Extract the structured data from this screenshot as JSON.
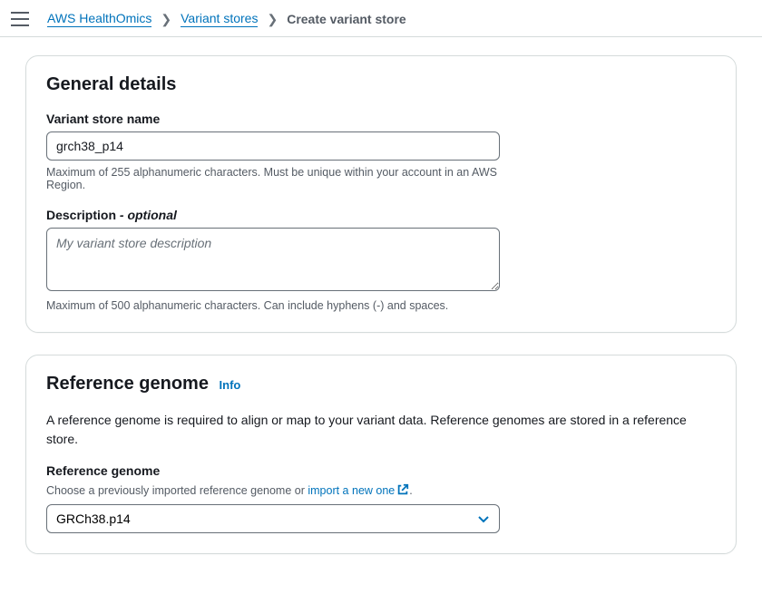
{
  "breadcrumb": {
    "root": "AWS HealthOmics",
    "mid": "Variant stores",
    "current": "Create variant store"
  },
  "general": {
    "title": "General details",
    "name_label": "Variant store name",
    "name_value": "grch38_p14",
    "name_hint": "Maximum of 255 alphanumeric characters. Must be unique within your account in an AWS Region.",
    "desc_label": "Description",
    "desc_optional": "- optional",
    "desc_placeholder": "My variant store description",
    "desc_hint": "Maximum of 500 alphanumeric characters. Can include hyphens (-) and spaces."
  },
  "ref": {
    "title": "Reference genome",
    "info": "Info",
    "desc": "A reference genome is required to align or map to your variant data. Reference genomes are stored in a reference store.",
    "field_label": "Reference genome",
    "field_hint_prefix": "Choose a previously imported reference genome or ",
    "import_link": "import a new one",
    "field_hint_suffix": ".",
    "selected": "GRCh38.p14"
  }
}
